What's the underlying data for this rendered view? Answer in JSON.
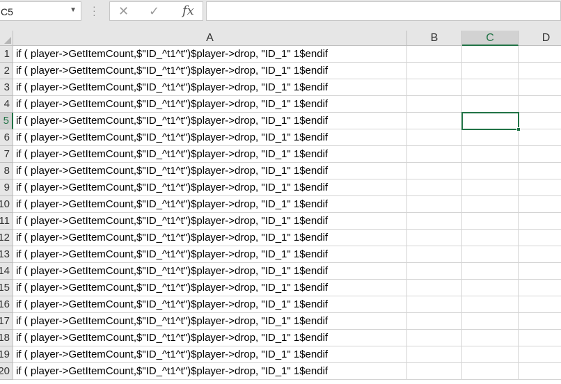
{
  "namebox": {
    "value": "C5",
    "dropdown_icon": "chevron-down-icon"
  },
  "formula_bar": {
    "cancel_icon": "close-icon",
    "enter_icon": "checkmark-icon",
    "fx_label": "fx",
    "value": ""
  },
  "columns": [
    "A",
    "B",
    "C",
    "D"
  ],
  "selected_cell": "C5",
  "rows": [
    {
      "num": "1",
      "a": "if ( player->GetItemCount,$\"ID_^t1^t\")$player->drop, \"ID_1\" 1$endif"
    },
    {
      "num": "2",
      "a": "if ( player->GetItemCount,$\"ID_^t1^t\")$player->drop, \"ID_1\" 1$endif"
    },
    {
      "num": "3",
      "a": "if ( player->GetItemCount,$\"ID_^t1^t\")$player->drop, \"ID_1\" 1$endif"
    },
    {
      "num": "4",
      "a": "if ( player->GetItemCount,$\"ID_^t1^t\")$player->drop, \"ID_1\" 1$endif"
    },
    {
      "num": "5",
      "a": "if ( player->GetItemCount,$\"ID_^t1^t\")$player->drop, \"ID_1\" 1$endif"
    },
    {
      "num": "6",
      "a": "if ( player->GetItemCount,$\"ID_^t1^t\")$player->drop, \"ID_1\" 1$endif"
    },
    {
      "num": "7",
      "a": "if ( player->GetItemCount,$\"ID_^t1^t\")$player->drop, \"ID_1\" 1$endif"
    },
    {
      "num": "8",
      "a": "if ( player->GetItemCount,$\"ID_^t1^t\")$player->drop, \"ID_1\" 1$endif"
    },
    {
      "num": "9",
      "a": "if ( player->GetItemCount,$\"ID_^t1^t\")$player->drop, \"ID_1\" 1$endif"
    },
    {
      "num": "10",
      "a": "if ( player->GetItemCount,$\"ID_^t1^t\")$player->drop, \"ID_1\" 1$endif"
    },
    {
      "num": "11",
      "a": "if ( player->GetItemCount,$\"ID_^t1^t\")$player->drop, \"ID_1\" 1$endif"
    },
    {
      "num": "12",
      "a": "if ( player->GetItemCount,$\"ID_^t1^t\")$player->drop, \"ID_1\" 1$endif"
    },
    {
      "num": "13",
      "a": "if ( player->GetItemCount,$\"ID_^t1^t\")$player->drop, \"ID_1\" 1$endif"
    },
    {
      "num": "14",
      "a": "if ( player->GetItemCount,$\"ID_^t1^t\")$player->drop, \"ID_1\" 1$endif"
    },
    {
      "num": "15",
      "a": "if ( player->GetItemCount,$\"ID_^t1^t\")$player->drop, \"ID_1\" 1$endif"
    },
    {
      "num": "16",
      "a": "if ( player->GetItemCount,$\"ID_^t1^t\")$player->drop, \"ID_1\" 1$endif"
    },
    {
      "num": "17",
      "a": "if ( player->GetItemCount,$\"ID_^t1^t\")$player->drop, \"ID_1\" 1$endif"
    },
    {
      "num": "18",
      "a": "if ( player->GetItemCount,$\"ID_^t1^t\")$player->drop, \"ID_1\" 1$endif"
    },
    {
      "num": "19",
      "a": "if ( player->GetItemCount,$\"ID_^t1^t\")$player->drop, \"ID_1\" 1$endif"
    },
    {
      "num": "20",
      "a": "if ( player->GetItemCount,$\"ID_^t1^t\")$player->drop, \"ID_1\" 1$endif"
    }
  ],
  "colors": {
    "accent": "#217346",
    "header_bg": "#e6e6e6",
    "gridline": "#d4d4d4"
  }
}
